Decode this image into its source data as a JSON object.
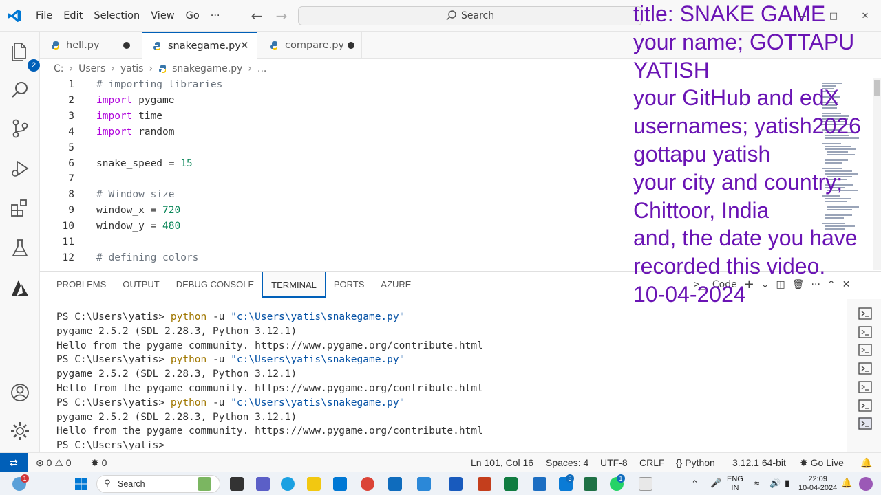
{
  "menu": [
    "File",
    "Edit",
    "Selection",
    "View",
    "Go",
    "···"
  ],
  "search": {
    "label": "Search"
  },
  "activity": {
    "explorer_badge": "2"
  },
  "tabs": [
    {
      "label": "hell.py",
      "modified": true
    },
    {
      "label": "snakegame.py",
      "active": true
    },
    {
      "label": "compare.py",
      "modified": true
    }
  ],
  "breadcrumb": [
    "C:",
    "Users",
    "yatis",
    "snakegame.py",
    "..."
  ],
  "editor_lines": [
    {
      "n": "1",
      "parts": [
        [
          "cm",
          "# importing libraries"
        ]
      ]
    },
    {
      "n": "2",
      "parts": [
        [
          "kw",
          "import"
        ],
        [
          "plain",
          " pygame"
        ]
      ]
    },
    {
      "n": "3",
      "parts": [
        [
          "kw",
          "import"
        ],
        [
          "plain",
          " time"
        ]
      ]
    },
    {
      "n": "4",
      "parts": [
        [
          "kw",
          "import"
        ],
        [
          "plain",
          " random"
        ]
      ]
    },
    {
      "n": "5",
      "parts": []
    },
    {
      "n": "6",
      "parts": [
        [
          "plain",
          "snake_speed = "
        ],
        [
          "num",
          "15"
        ]
      ]
    },
    {
      "n": "7",
      "parts": []
    },
    {
      "n": "8",
      "parts": [
        [
          "cm",
          "# Window size"
        ]
      ]
    },
    {
      "n": "9",
      "parts": [
        [
          "plain",
          "window_x = "
        ],
        [
          "num",
          "720"
        ]
      ]
    },
    {
      "n": "10",
      "parts": [
        [
          "plain",
          "window_y = "
        ],
        [
          "num",
          "480"
        ]
      ]
    },
    {
      "n": "11",
      "parts": []
    },
    {
      "n": "12",
      "parts": [
        [
          "cm",
          "# defining colors"
        ]
      ]
    }
  ],
  "panel": {
    "tabs": [
      "PROBLEMS",
      "OUTPUT",
      "DEBUG CONSOLE",
      "TERMINAL",
      "PORTS",
      "AZURE"
    ],
    "active_tab": "TERMINAL",
    "terminal_name": "Code",
    "terminal_lines": [
      {
        "prompt": "PS C:\\Users\\yatis> ",
        "cmd": "python",
        "args": " -u ",
        "str": "\"c:\\Users\\yatis\\snakegame.py\""
      },
      {
        "text": "pygame 2.5.2 (SDL 2.28.3, Python 3.12.1)"
      },
      {
        "text": "Hello from the pygame community. https://www.pygame.org/contribute.html"
      },
      {
        "prompt": "PS C:\\Users\\yatis> ",
        "cmd": "python",
        "args": " -u ",
        "str": "\"c:\\Users\\yatis\\snakegame.py\""
      },
      {
        "text": "pygame 2.5.2 (SDL 2.28.3, Python 3.12.1)"
      },
      {
        "text": "Hello from the pygame community. https://www.pygame.org/contribute.html"
      },
      {
        "prompt": "PS C:\\Users\\yatis> ",
        "cmd": "python",
        "args": " -u ",
        "str": "\"c:\\Users\\yatis\\snakegame.py\""
      },
      {
        "text": "pygame 2.5.2 (SDL 2.28.3, Python 3.12.1)"
      },
      {
        "text": "Hello from the pygame community. https://www.pygame.org/contribute.html"
      },
      {
        "text": "PS C:\\Users\\yatis>"
      }
    ]
  },
  "statusbar": {
    "errors": "0",
    "warnings": "0",
    "ports": "0",
    "position": "Ln 101, Col 16",
    "spaces": "Spaces: 4",
    "encoding": "UTF-8",
    "eol": "CRLF",
    "language": "Python",
    "interpreter": "3.12.1 64-bit",
    "golive": "Go Live"
  },
  "taskbar": {
    "search_label": "Search",
    "lang": "ENG",
    "region": "IN",
    "time": "22:09",
    "date": "10-04-2024",
    "notif_badge_1": "1",
    "notif_badge_2": "3",
    "notif_badge_3": "1"
  },
  "overlay_lines": [
    "title: SNAKE GAME",
    "your name; GOTTAPU",
    "YATISH",
    "your GitHub and edX",
    "usernames; yatish2026",
    "gottapu yatish",
    "your city and country;",
    "Chittoor, India",
    "and, the date you have",
    "recorded this video.",
    "10-04-2024"
  ],
  "colors": {
    "accent": "#005fb8",
    "overlay": "#6a14b4",
    "keyword": "#af00db",
    "number": "#098658"
  }
}
